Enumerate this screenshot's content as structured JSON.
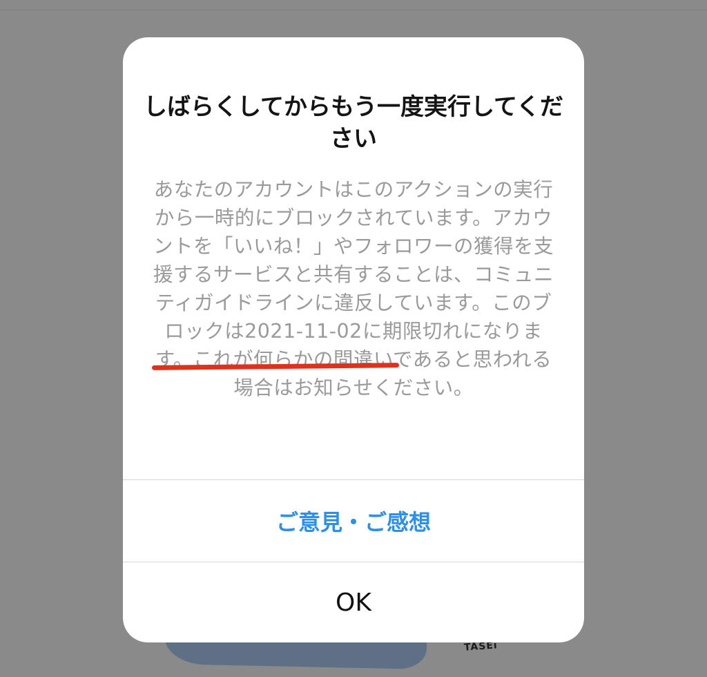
{
  "background": {
    "signature": "TÄSEi"
  },
  "alert": {
    "title": "しばらくしてからもう一度実行してください",
    "message_before_date": "あなたのアカウントはこのアクションの実行から一時的にブロックされています。アカウントを「いいね！」やフォロワーの獲得を支援するサービスと共有することは、コミュニティガイドラインに違反しています。このブロックは",
    "expiry_date": "2021-11-02",
    "message_expiry_phrase": "に期限切れ",
    "message_after_date": "になります。これが何らかの間違いであると思われる場合はお知らせください。",
    "feedback_button": "ご意見・ご感想",
    "ok_button": "OK",
    "colors": {
      "link_blue": "#2f8fe2",
      "annotation_red": "#e0311f",
      "body_gray": "#9a9a9a"
    }
  }
}
